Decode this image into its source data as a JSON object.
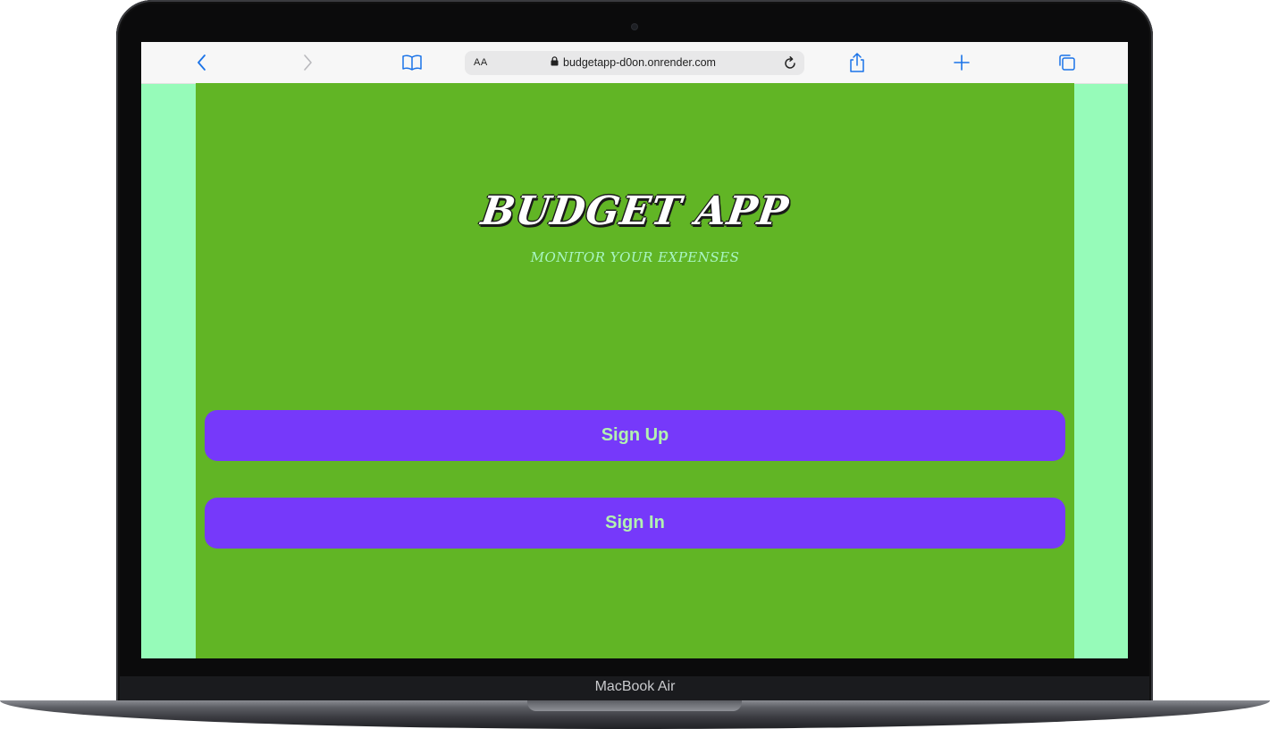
{
  "browser": {
    "text_size_label": "AA",
    "url": "budgetapp-d0on.onrender.com"
  },
  "page": {
    "title": "BUDGET APP",
    "subtitle": "MONITOR YOUR EXPENSES",
    "sign_up_label": "Sign Up",
    "sign_in_label": "Sign In"
  },
  "device": {
    "model_label": "MacBook Air"
  },
  "colors": {
    "page_background": "#61b525",
    "side_background": "#96fbb9",
    "button_background": "#7639fa",
    "button_text": "#b2f2b0",
    "subtitle": "#a9f6c4",
    "browser_accent": "#1a73e8"
  }
}
